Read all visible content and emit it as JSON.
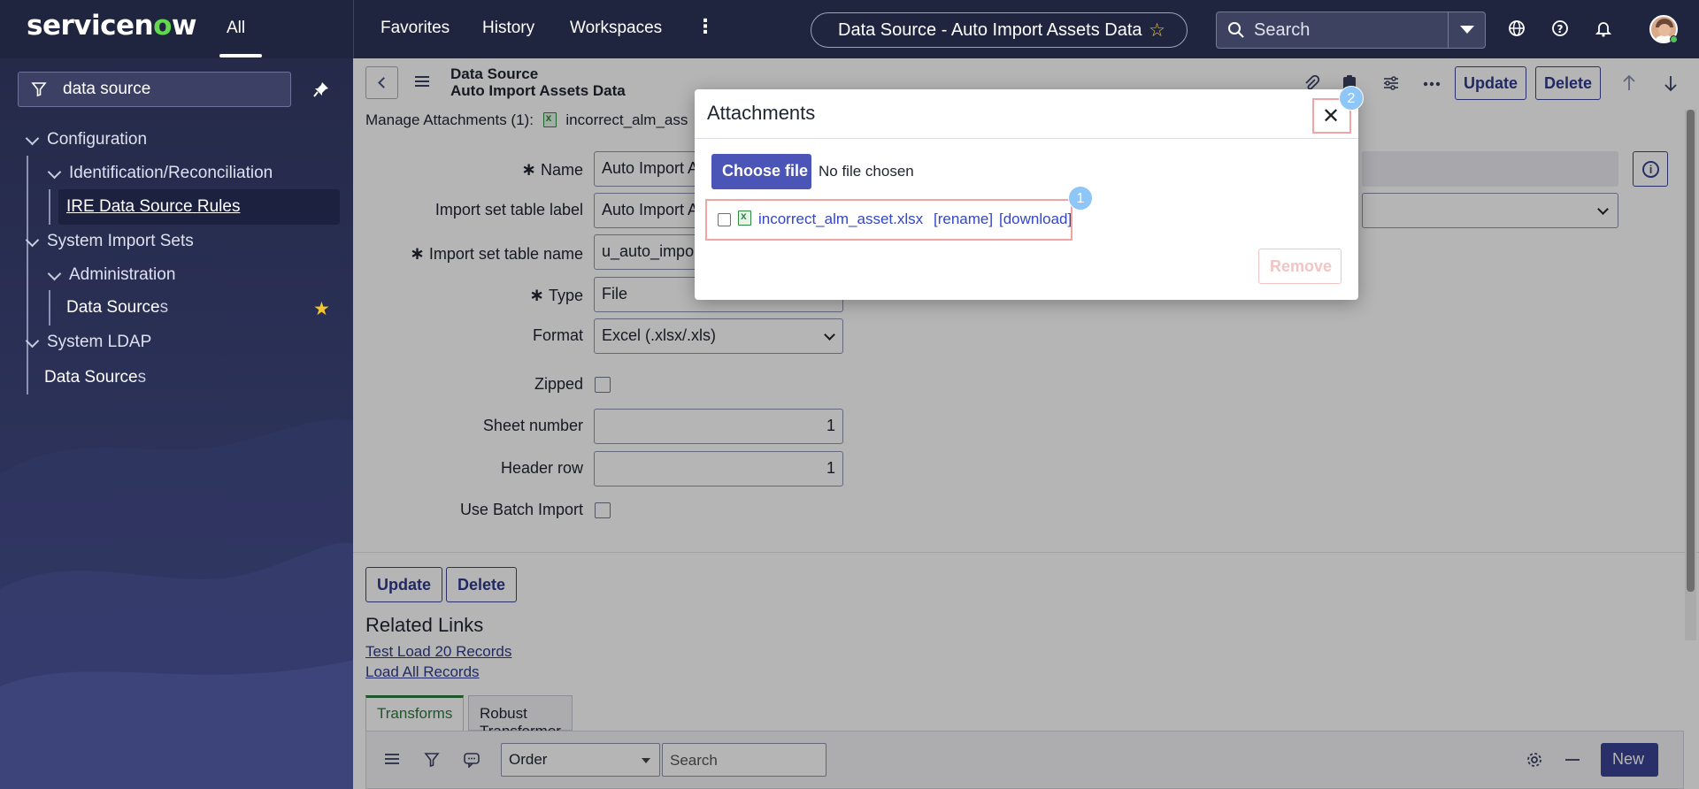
{
  "app": {
    "logo_part1": "servicen",
    "logo_o": "o",
    "logo_part2": "w",
    "tab_all": "All"
  },
  "topnav": {
    "favorites": "Favorites",
    "history": "History",
    "workspaces": "Workspaces"
  },
  "title_pill": "Data Source - Auto Import Assets Data",
  "global_search": {
    "placeholder": "Search"
  },
  "sidebar": {
    "filter_value": "data source",
    "items": [
      {
        "label": "Configuration"
      },
      {
        "label": "Identification/Reconciliation"
      },
      {
        "label_u1": "IRE",
        "label_u2": "Data Source",
        "label_u3": "Rules"
      },
      {
        "label": "System Import Sets"
      },
      {
        "label": "Administration"
      },
      {
        "label_bold": "Data Source",
        "label_rest": "s"
      },
      {
        "label": "System LDAP"
      },
      {
        "label_bold": "Data Source",
        "label_rest": "s"
      }
    ]
  },
  "form_header": {
    "line1": "Data Source",
    "line2": "Auto Import Assets Data",
    "update": "Update",
    "delete": "Delete"
  },
  "attachments_row": {
    "label": "Manage Attachments (1):",
    "file": "incorrect_alm_ass"
  },
  "form": {
    "name_label": "Name",
    "name_value": "Auto Import A",
    "isl_label": "Import set table label",
    "isl_value": "Auto Import A",
    "istn_label": "Import set table name",
    "istn_value": "u_auto_impor",
    "type_label": "Type",
    "type_value": "File",
    "format_label": "Format",
    "format_value": "Excel (.xlsx/.xls)",
    "zipped_label": "Zipped",
    "sheet_label": "Sheet number",
    "sheet_value": "1",
    "header_label": "Header row",
    "header_value": "1",
    "batch_label": "Use Batch Import"
  },
  "footer_buttons": {
    "update": "Update",
    "delete": "Delete"
  },
  "related_links": {
    "title": "Related Links",
    "links": [
      "Test Load 20 Records",
      "Load All Records"
    ]
  },
  "tabs": [
    "Transforms",
    "Robust Transformer"
  ],
  "list_bar": {
    "order": "Order",
    "search_placeholder": "Search",
    "new": "New"
  },
  "modal": {
    "title": "Attachments",
    "choose_file": "Choose file",
    "no_file": "No file chosen",
    "file_name": "incorrect_alm_asset.xlsx",
    "rename": "[rename]",
    "download": "[download]",
    "remove": "Remove",
    "badge1": "1",
    "badge2": "2"
  },
  "colors": {
    "topbar": "#20253f",
    "accent": "#3a4494",
    "logo_o": "#62d84e",
    "highlight": "#f0a5a5",
    "badge": "#8ec6f7"
  }
}
